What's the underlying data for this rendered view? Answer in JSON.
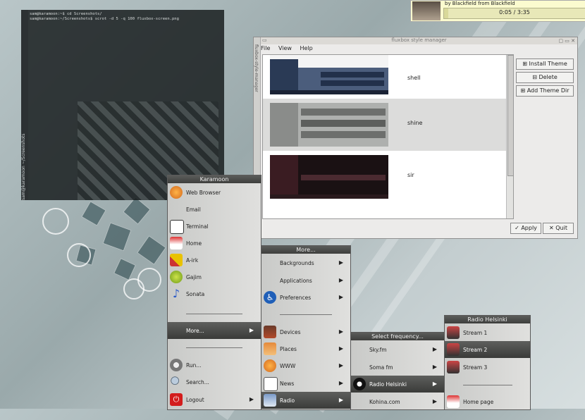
{
  "terminal": {
    "side_label": "sam@karamoon ~/Screenshots",
    "lines": [
      "sam@karamoon:~$ cd Screenshots/",
      "sam@karamoon:~/Screenshots$ scrot -d 5 -q 100 fluxbox-screen.png"
    ]
  },
  "music": {
    "by_line": "by Blackfield from Blackfield",
    "time": "0:05 / 3:35",
    "progress_fraction": 0.03
  },
  "style_manager": {
    "title": "fluxbox style manager",
    "side_label": "fluxbox-style-manager",
    "menu": [
      "File",
      "View",
      "Help"
    ],
    "styles": [
      "shell",
      "shine",
      "sir"
    ],
    "buttons": {
      "install": "Install Theme",
      "delete": "Delete",
      "add_dir": "Add Theme Dir",
      "apply": "Apply",
      "quit": "Quit"
    }
  },
  "main_menu": {
    "title": "Karamoon",
    "items": [
      "Web Browser",
      "Email",
      "Terminal",
      "Home",
      "A-irk",
      "Gajim",
      "Sonata",
      "More...",
      "Run...",
      "Search...",
      "Logout"
    ]
  },
  "more_menu": {
    "title": "More...",
    "items": [
      "Backgrounds",
      "Applications",
      "Preferences",
      "Devices",
      "Places",
      "WWW",
      "News",
      "Radio"
    ]
  },
  "freq_menu": {
    "title": "Select frequency...",
    "items": [
      "Sky.fm",
      "Soma fm",
      "Radio Helsinki",
      "Kohina.com"
    ]
  },
  "helsinki_menu": {
    "title": "Radio Helsinki",
    "items": [
      "Stream 1",
      "Stream 2",
      "Stream 3",
      "Home page"
    ]
  }
}
